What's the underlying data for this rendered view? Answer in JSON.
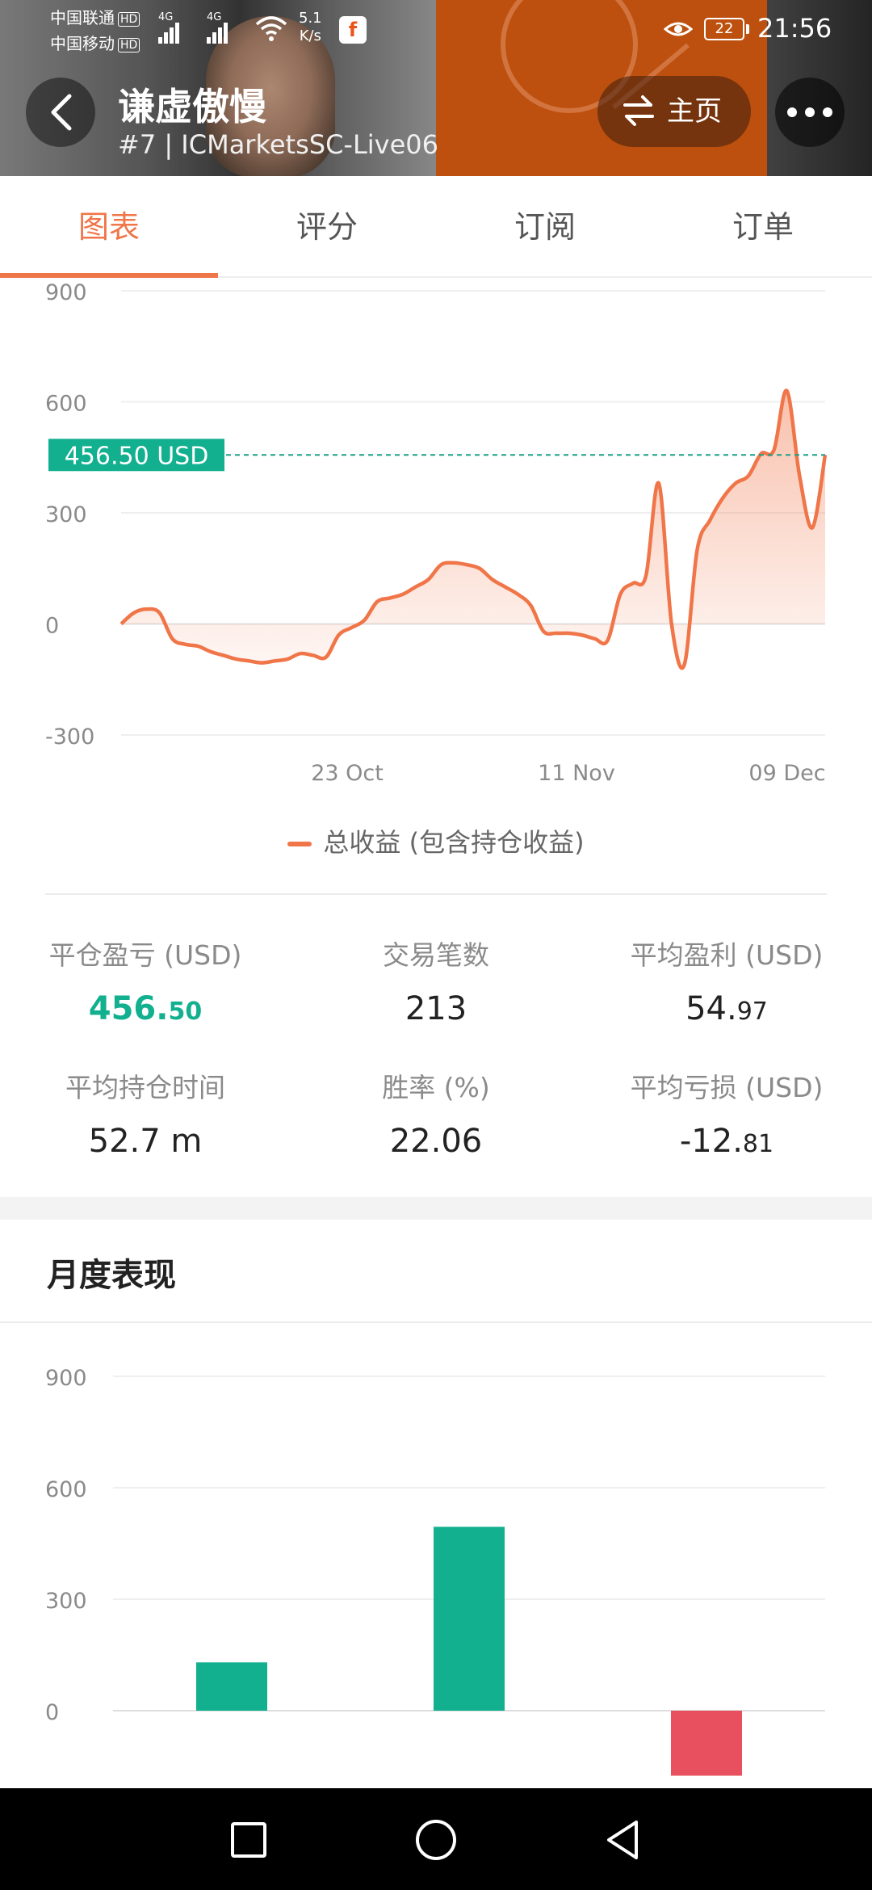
{
  "status_bar": {
    "carrier1": "中国联通",
    "carrier2": "中国移动",
    "hd": "HD",
    "net_type": "4G",
    "net_speed_value": "5.1",
    "net_speed_unit": "K/s",
    "battery": "22",
    "time": "21:56"
  },
  "header": {
    "name": "谦虚傲慢",
    "subtitle": "#7 | ICMarketsSC-Live06",
    "home_button": "主页"
  },
  "tabs": [
    {
      "label": "图表",
      "active": true
    },
    {
      "label": "评分",
      "active": false
    },
    {
      "label": "订阅",
      "active": false
    },
    {
      "label": "订单",
      "active": false
    }
  ],
  "chart_data": [
    {
      "type": "area",
      "yticks": [
        "900",
        "600",
        "300",
        "0",
        "-300"
      ],
      "ylim": [
        -300,
        900
      ],
      "xticks": [
        "23 Oct",
        "11 Nov",
        "09 Dec"
      ],
      "current_value_label": "456.50 USD",
      "current_value": 456.5,
      "series": [
        {
          "name": "总收益 (包含持仓收益)",
          "color": "#f07548",
          "values": [
            0,
            30,
            40,
            30,
            -40,
            -55,
            -60,
            -75,
            -85,
            -95,
            -100,
            -105,
            -100,
            -95,
            -80,
            -85,
            -90,
            -30,
            -10,
            10,
            60,
            70,
            80,
            100,
            120,
            160,
            165,
            160,
            150,
            120,
            100,
            80,
            50,
            -20,
            -25,
            -25,
            -30,
            -40,
            -45,
            80,
            110,
            130,
            380,
            0,
            -110,
            200,
            280,
            340,
            380,
            400,
            460,
            470,
            630,
            400,
            260,
            456.5
          ]
        }
      ],
      "grid": true
    },
    {
      "type": "bar",
      "yticks": [
        "900",
        "600",
        "300",
        "0"
      ],
      "ylim": [
        -200,
        900
      ],
      "values": [
        130,
        495,
        -175
      ],
      "colors": [
        "#12b08f",
        "#12b08f",
        "#e9505f"
      ],
      "grid": true
    }
  ],
  "stats": [
    {
      "label": "平仓盈亏 (USD)",
      "int": "456.",
      "dec": "50",
      "color": "green"
    },
    {
      "label": "交易笔数",
      "int": "213",
      "dec": "",
      "color": "normal"
    },
    {
      "label": "平均盈利 (USD)",
      "int": "54.",
      "dec": "97",
      "color": "normal"
    },
    {
      "label": "平均持仓时间",
      "int": "52.7 m",
      "dec": "",
      "color": "normal"
    },
    {
      "label": "胜率 (%)",
      "int": "22.06",
      "dec": "",
      "color": "normal"
    },
    {
      "label": "平均亏损 (USD)",
      "int": "-12.",
      "dec": "81",
      "color": "normal"
    }
  ],
  "monthly": {
    "title": "月度表现"
  },
  "colors": {
    "accent": "#f07548",
    "green": "#12b08f",
    "red": "#e9505f",
    "dashed": "#1aa08a"
  }
}
